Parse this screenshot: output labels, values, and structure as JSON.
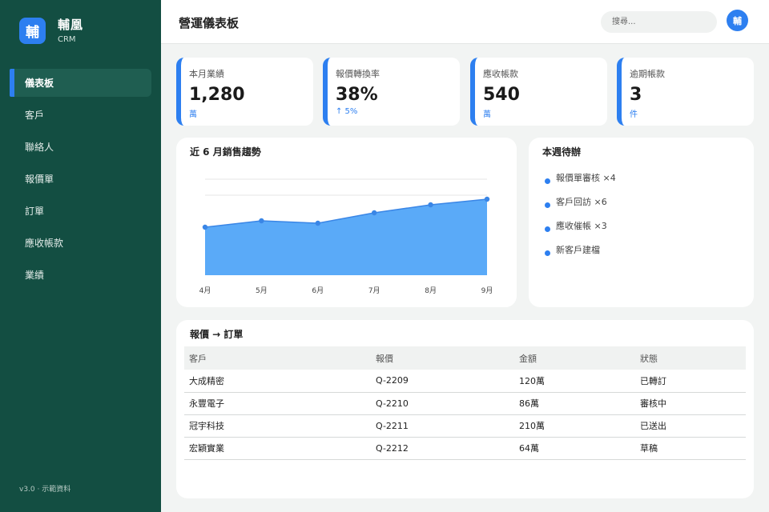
{
  "brand": {
    "logo_char": "輔",
    "name": "輔凰",
    "sub": "CRM"
  },
  "sidebar": {
    "items": [
      {
        "label": "儀表板",
        "active": true
      },
      {
        "label": "客戶"
      },
      {
        "label": "聯絡人"
      },
      {
        "label": "報價單"
      },
      {
        "label": "訂單"
      },
      {
        "label": "應收帳款"
      },
      {
        "label": "業績"
      }
    ],
    "version": "v3.0 · 示範資料"
  },
  "header": {
    "title": "營運儀表板",
    "search_placeholder": "搜尋...",
    "avatar_char": "輔"
  },
  "kpis": [
    {
      "label": "本月業績",
      "value": "1,280",
      "sub": "萬"
    },
    {
      "label": "報價轉換率",
      "value": "38%",
      "sub": "↑ 5%"
    },
    {
      "label": "應收帳款",
      "value": "540",
      "sub": "萬"
    },
    {
      "label": "逾期帳款",
      "value": "3",
      "sub": "件"
    }
  ],
  "chart": {
    "title": "近 6 月銷售趨勢",
    "chart_data": {
      "type": "area",
      "title": "近 6 月銷售趨勢",
      "categories": [
        "4月",
        "5月",
        "6月",
        "7月",
        "8月",
        "9月"
      ],
      "values": [
        60,
        68,
        65,
        78,
        88,
        95
      ],
      "ylim": [
        0,
        150
      ],
      "grid": true,
      "color": "#5aaaf8",
      "line_color": "#3a86e6"
    }
  },
  "todo": {
    "title": "本週待辦",
    "items": [
      "報價單審核 ×4",
      "客戶回訪 ×6",
      "應收催帳 ×3",
      "新客戶建檔"
    ]
  },
  "orders": {
    "title": "報價 → 訂單",
    "columns": [
      "客戶",
      "報價",
      "金額",
      "狀態"
    ],
    "rows": [
      [
        "大成精密",
        "Q-2209",
        "120萬",
        "已轉訂"
      ],
      [
        "永豐電子",
        "Q-2210",
        "86萬",
        "審核中"
      ],
      [
        "冠宇科技",
        "Q-2211",
        "210萬",
        "已送出"
      ],
      [
        "宏穎實業",
        "Q-2212",
        "64萬",
        "草稿"
      ]
    ]
  },
  "colors": {
    "sidebar": "#134e42",
    "accent": "#2d7ff0",
    "background": "#f2f4f3"
  }
}
